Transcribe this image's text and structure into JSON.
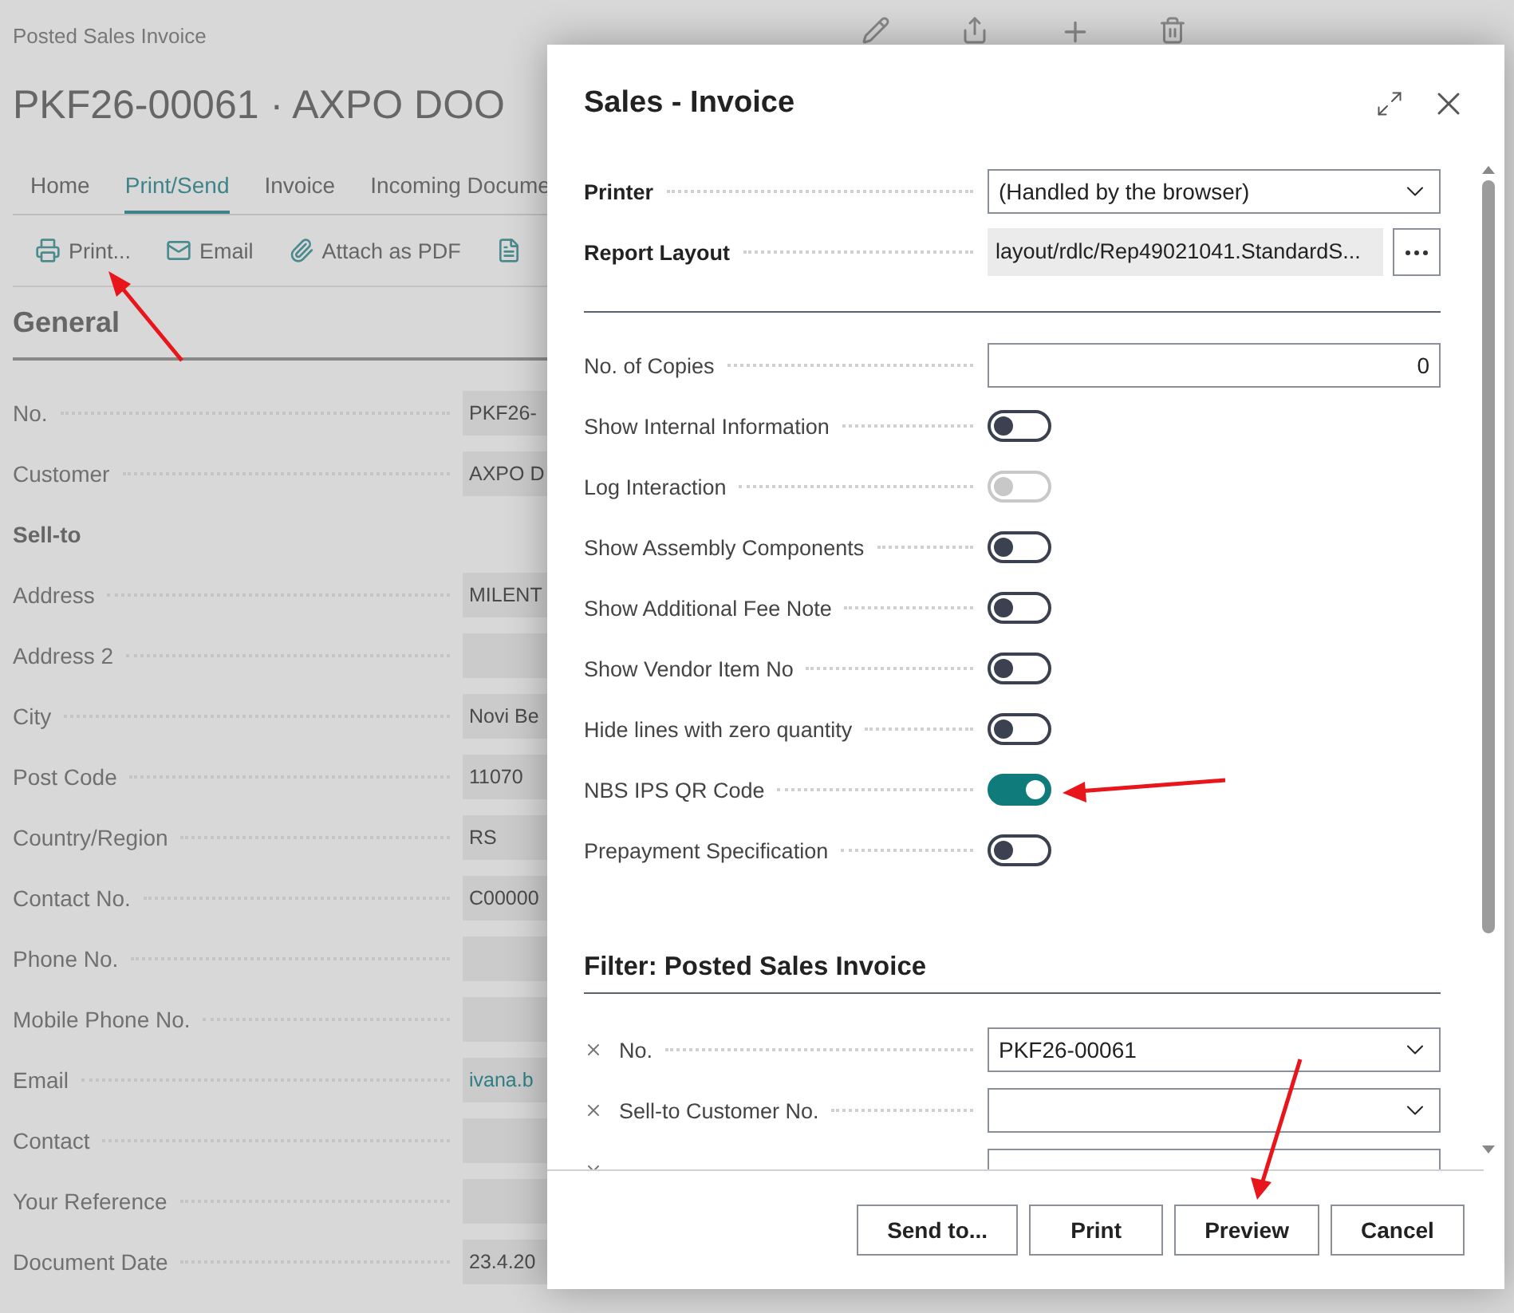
{
  "page": {
    "breadcrumb": "Posted Sales Invoice",
    "title": "PKF26-00061 · AXPO DOO",
    "tabs": [
      {
        "label": "Home",
        "selected": false
      },
      {
        "label": "Print/Send",
        "selected": true
      },
      {
        "label": "Invoice",
        "selected": false
      },
      {
        "label": "Incoming Docume",
        "selected": false
      }
    ],
    "actions": [
      "Print...",
      "Email",
      "Attach as PDF"
    ],
    "section": "General",
    "fields": [
      {
        "kind": "field",
        "label": "No.",
        "value": "PKF26-"
      },
      {
        "kind": "field",
        "label": "Customer",
        "value": "AXPO D"
      },
      {
        "kind": "group",
        "label": "Sell-to"
      },
      {
        "kind": "field",
        "label": "Address",
        "value": "MILENT"
      },
      {
        "kind": "field",
        "label": "Address 2"
      },
      {
        "kind": "field",
        "label": "City",
        "value": "Novi Be"
      },
      {
        "kind": "field",
        "label": "Post Code",
        "value": "11070"
      },
      {
        "kind": "field",
        "label": "Country/Region",
        "value": "RS"
      },
      {
        "kind": "field",
        "label": "Contact No.",
        "value": "C00000"
      },
      {
        "kind": "field",
        "label": "Phone No."
      },
      {
        "kind": "field",
        "label": "Mobile Phone No."
      },
      {
        "kind": "link",
        "label": "Email",
        "value": "ivana.b"
      },
      {
        "kind": "field",
        "label": "Contact"
      },
      {
        "kind": "field",
        "label": "Your Reference"
      },
      {
        "kind": "field",
        "label": "Document Date",
        "value": "23.4.20"
      }
    ]
  },
  "dialog": {
    "title": "Sales - Invoice",
    "printer": {
      "label": "Printer",
      "value": "(Handled by the browser)"
    },
    "report_layout": {
      "label": "Report Layout",
      "value": "layout/rdlc/Rep49021041.StandardS..."
    },
    "options": [
      {
        "kind": "number",
        "label": "No. of Copies",
        "value": "0"
      },
      {
        "kind": "toggle",
        "label": "Show Internal Information",
        "on": false,
        "disabled": false
      },
      {
        "kind": "toggle",
        "label": "Log Interaction",
        "on": false,
        "disabled": true
      },
      {
        "kind": "toggle",
        "label": "Show Assembly Components",
        "on": false,
        "disabled": false
      },
      {
        "kind": "toggle",
        "label": "Show Additional Fee Note",
        "on": false,
        "disabled": false
      },
      {
        "kind": "toggle",
        "label": "Show Vendor Item No",
        "on": false,
        "disabled": false
      },
      {
        "kind": "toggle",
        "label": "Hide lines with zero quantity",
        "on": false,
        "disabled": false
      },
      {
        "kind": "toggle",
        "label": "NBS IPS QR Code",
        "on": true,
        "disabled": false
      },
      {
        "kind": "toggle",
        "label": "Prepayment Specification",
        "on": false,
        "disabled": false
      }
    ],
    "filter": {
      "title": "Filter: Posted Sales Invoice",
      "rows": [
        {
          "kind": "select",
          "label": "No.",
          "value": "PKF26-00061"
        },
        {
          "kind": "select",
          "label": "Sell-to Customer No."
        },
        {
          "kind": "text"
        }
      ]
    },
    "buttons": [
      "Send to...",
      "Print",
      "Preview",
      "Cancel"
    ]
  }
}
